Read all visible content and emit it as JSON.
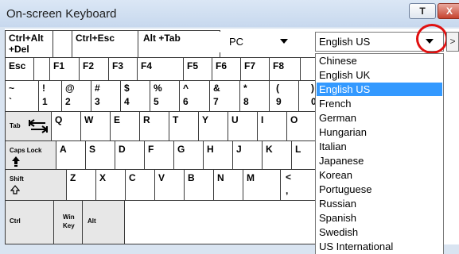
{
  "window": {
    "title": "On-screen Keyboard"
  },
  "titlebar": {
    "pin_label": "T",
    "close_label": "X"
  },
  "rows": {
    "r1": {
      "ctrl_alt_del_1": "Ctrl+Alt",
      "ctrl_alt_del_2": "+Del",
      "ctrl_esc": "Ctrl+Esc",
      "alt_tab": "Alt +Tab"
    },
    "r2": {
      "esc": "Esc",
      "f1": "F1",
      "f2": "F2",
      "f3": "F3",
      "f4": "F4",
      "f5": "F5",
      "f6": "F6",
      "f7": "F7",
      "f8": "F8"
    },
    "r3": [
      {
        "top": "~",
        "bottom": "`"
      },
      {
        "top": "!",
        "bottom": "1"
      },
      {
        "top": "@",
        "bottom": "2"
      },
      {
        "top": "#",
        "bottom": "3"
      },
      {
        "top": "$",
        "bottom": "4"
      },
      {
        "top": "%",
        "bottom": "5"
      },
      {
        "top": "^",
        "bottom": "6"
      },
      {
        "top": "&",
        "bottom": "7"
      },
      {
        "top": "*",
        "bottom": "8"
      },
      {
        "top": "(",
        "bottom": "9"
      },
      {
        "top": ")",
        "bottom": "0"
      }
    ],
    "r4": {
      "tab": "Tab",
      "keys": [
        "Q",
        "W",
        "E",
        "R",
        "T",
        "Y",
        "U",
        "I",
        "O"
      ]
    },
    "r5": {
      "caps": "Caps Lock",
      "keys": [
        "A",
        "S",
        "D",
        "F",
        "G",
        "H",
        "J",
        "K",
        "L"
      ]
    },
    "r6": {
      "shift": "Shift",
      "keys": [
        "Z",
        "X",
        "C",
        "V",
        "B",
        "N",
        "M"
      ],
      "comma_top": "<",
      "comma_bottom": ","
    },
    "r7": {
      "ctrl": "Ctrl",
      "win1": "Win",
      "win2": "Key",
      "alt": "Alt"
    }
  },
  "layout_select": {
    "value": "PC"
  },
  "language_select": {
    "value": "English US",
    "scroll_glyph": ">",
    "options": [
      "Chinese",
      "English UK",
      "English US",
      "French",
      "German",
      "Hungarian",
      "Italian",
      "Japanese",
      "Korean",
      "Portuguese",
      "Russian",
      "Spanish",
      "Swedish",
      "US International"
    ],
    "selected_index": 2
  },
  "icons": {
    "tab_arrows": "tab-arrows-icon",
    "caps_arrow": "caps-up-arrow-icon",
    "shift_arrow": "shift-up-arrow-icon",
    "dropdown": "chevron-down-icon"
  },
  "colors": {
    "selection": "#3399ff",
    "highlight_circle": "#e01010",
    "close": "#c6432f"
  }
}
